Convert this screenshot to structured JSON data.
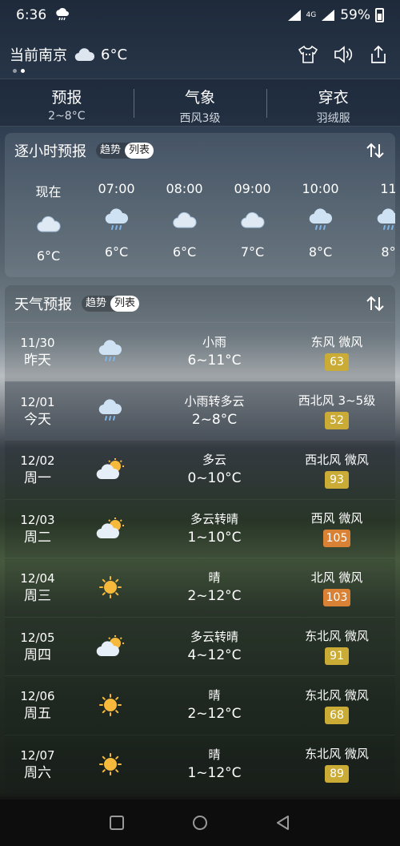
{
  "status": {
    "time": "6:36",
    "network": "4G",
    "battery": "59%"
  },
  "header": {
    "city": "当前南京",
    "temp": "6°C",
    "weather_icon": "cloud-icon"
  },
  "summary": [
    {
      "title": "预报",
      "sub": "2~8°C"
    },
    {
      "title": "气象",
      "sub": "西风3级"
    },
    {
      "title": "穿衣",
      "sub": "羽绒服"
    }
  ],
  "hourly": {
    "title": "逐小时预报",
    "toggle": {
      "trend": "趋势",
      "list": "列表"
    },
    "items": [
      {
        "label": "现在",
        "icon": "cloud",
        "temp": "6°C"
      },
      {
        "label": "07:00",
        "icon": "rain",
        "temp": "6°C"
      },
      {
        "label": "08:00",
        "icon": "cloud",
        "temp": "6°C"
      },
      {
        "label": "09:00",
        "icon": "cloud",
        "temp": "7°C"
      },
      {
        "label": "10:00",
        "icon": "rain",
        "temp": "8°C"
      },
      {
        "label": "11",
        "icon": "rain",
        "temp": "8°"
      }
    ]
  },
  "daily": {
    "title": "天气预报",
    "toggle": {
      "trend": "趋势",
      "list": "列表"
    },
    "items": [
      {
        "date": "11/30",
        "weekday": "昨天",
        "icon": "rain",
        "cond": "小雨",
        "range": "6~11°C",
        "wind": "东风 微风",
        "aqi": "63",
        "aqi_color": "#c9ab35"
      },
      {
        "date": "12/01",
        "weekday": "今天",
        "icon": "rain",
        "cond": "小雨转多云",
        "range": "2~8°C",
        "wind": "西北风 3~5级",
        "aqi": "52",
        "aqi_color": "#c9ab35"
      },
      {
        "date": "12/02",
        "weekday": "周一",
        "icon": "partly",
        "cond": "多云",
        "range": "0~10°C",
        "wind": "西北风 微风",
        "aqi": "93",
        "aqi_color": "#c9ab35"
      },
      {
        "date": "12/03",
        "weekday": "周二",
        "icon": "partly",
        "cond": "多云转晴",
        "range": "1~10°C",
        "wind": "西风 微风",
        "aqi": "105",
        "aqi_color": "#d98236"
      },
      {
        "date": "12/04",
        "weekday": "周三",
        "icon": "sun",
        "cond": "晴",
        "range": "2~12°C",
        "wind": "北风 微风",
        "aqi": "103",
        "aqi_color": "#d98236"
      },
      {
        "date": "12/05",
        "weekday": "周四",
        "icon": "partly",
        "cond": "多云转晴",
        "range": "4~12°C",
        "wind": "东北风 微风",
        "aqi": "91",
        "aqi_color": "#c9ab35"
      },
      {
        "date": "12/06",
        "weekday": "周五",
        "icon": "sun",
        "cond": "晴",
        "range": "2~12°C",
        "wind": "东北风 微风",
        "aqi": "68",
        "aqi_color": "#c9ab35"
      },
      {
        "date": "12/07",
        "weekday": "周六",
        "icon": "sun",
        "cond": "晴",
        "range": "1~12°C",
        "wind": "东北风 微风",
        "aqi": "89",
        "aqi_color": "#c9ab35"
      }
    ]
  }
}
